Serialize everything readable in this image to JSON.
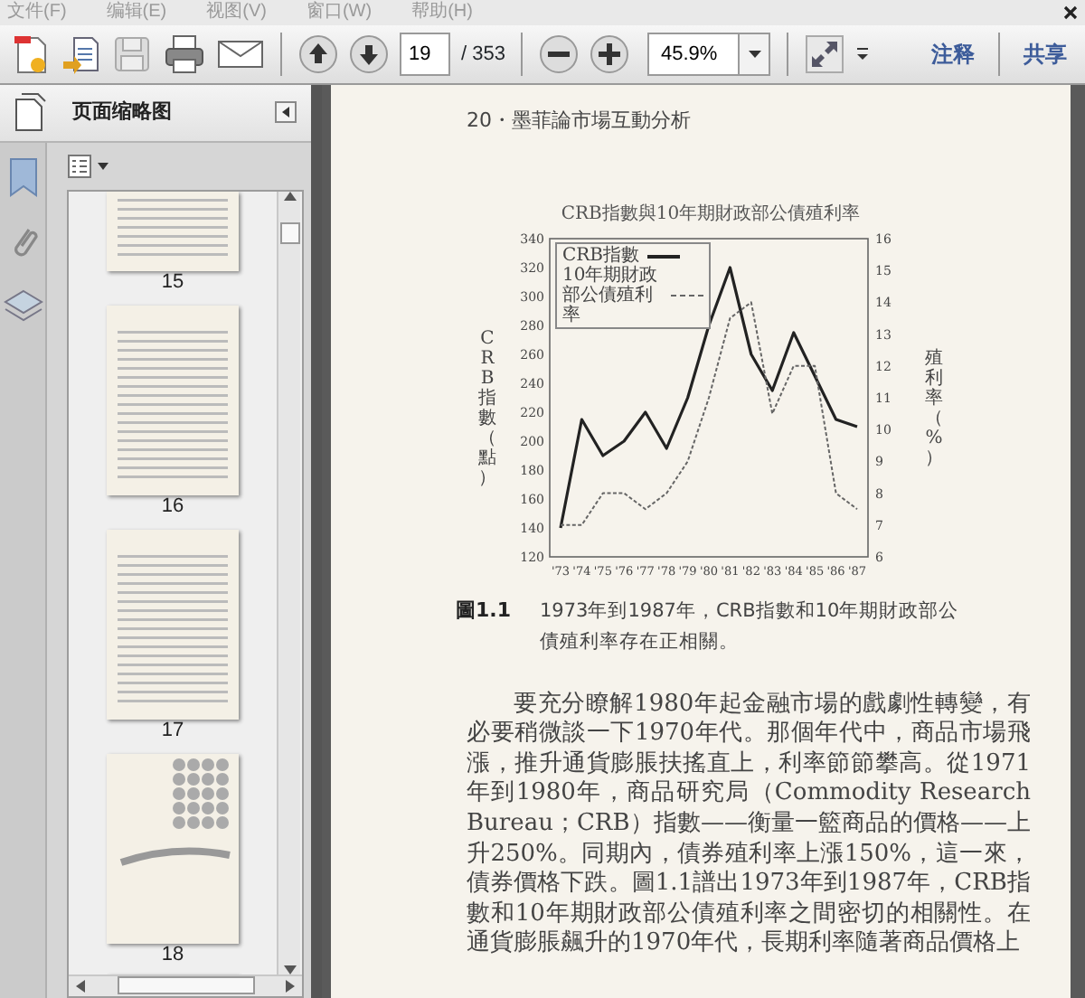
{
  "menu": [
    {
      "label": "文件(F)"
    },
    {
      "label": "编辑(E)"
    },
    {
      "label": "视图(V)"
    },
    {
      "label": "窗口(W)"
    },
    {
      "label": "帮助(H)"
    }
  ],
  "toolbar": {
    "page_number": "19",
    "page_total": "/ 353",
    "zoom": "45.9%",
    "comment": "注释",
    "share": "共享"
  },
  "left_panel": {
    "title": "页面缩略图",
    "thumbnails": [
      {
        "label": "15"
      },
      {
        "label": "16"
      },
      {
        "label": "17"
      },
      {
        "label": "18"
      }
    ]
  },
  "page": {
    "header": "20・墨菲論市場互動分析",
    "figure": {
      "chart_data": {
        "type": "line",
        "title": "CRB指數與10年期財政部公債殖利率",
        "ylabel": "CRB指數（點）",
        "y2label": "殖利率（%）",
        "categories": [
          "'73",
          "'74",
          "'75",
          "'76",
          "'77",
          "'78",
          "'79",
          "'80",
          "'81",
          "'82",
          "'83",
          "'84",
          "'85",
          "'86",
          "'87"
        ],
        "series": [
          {
            "name": "CRB指數",
            "color": "#222222",
            "line_style": "solid",
            "values": [
              140,
              215,
              190,
              200,
              220,
              195,
              230,
              280,
              320,
              260,
              235,
              275,
              245,
              215,
              210
            ]
          },
          {
            "name": "10年期財政部公債殖利率",
            "color": "#666666",
            "axis": "y2",
            "line_style": "dashed",
            "values": [
              7,
              7,
              8,
              8,
              7.5,
              8,
              9,
              11,
              13.5,
              14,
              10.5,
              12,
              12,
              8,
              7.5
            ]
          }
        ],
        "legend": "upper left",
        "ylim": [
          120,
          340
        ],
        "yticks": [
          120,
          140,
          160,
          180,
          200,
          220,
          240,
          260,
          280,
          300,
          320,
          340
        ],
        "y2lim": [
          6,
          16
        ],
        "y2ticks": [
          6,
          7,
          8,
          9,
          10,
          11,
          12,
          13,
          14,
          15,
          16
        ]
      }
    },
    "caption_number": "圖1.1",
    "caption_text": "1973年到1987年，CRB指數和10年期財政部公債殖利率存在正相關。",
    "paragraph": "要充分瞭解1980年起金融市場的戲劇性轉變，有必要稍微談一下1970年代。那個年代中，商品市場飛漲，推升通貨膨脹扶搖直上，利率節節攀高。從1971年到1980年，商品研究局（Commodity Research Bureau；CRB）指數——衡量一籃商品的價格——上升250%。同期內，債券殖利率上漲150%，這一來，債券價格下跌。圖1.1譜出1973年到1987年，CRB指數和10年期財政部公債殖利率之間密切的相關性。在通貨膨脹飆升的1970年代，長期利率隨著商品價格上"
  }
}
